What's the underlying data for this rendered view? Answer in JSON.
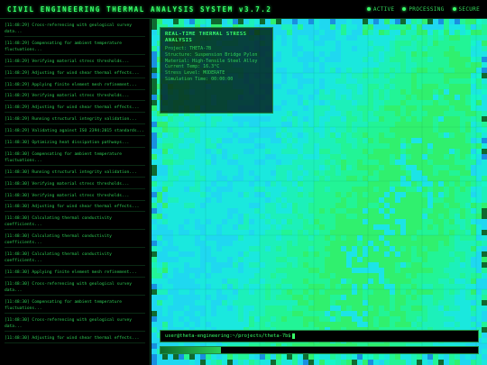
{
  "header": {
    "title": "CIVIL ENGINEERING THERMAL ANALYSIS SYSTEM v3.7.2",
    "status": [
      {
        "label": "ACTIVE",
        "color": "#39ff6a"
      },
      {
        "label": "PROCESSING",
        "color": "#39ff6a"
      },
      {
        "label": "SECURE",
        "color": "#39ff6a"
      }
    ]
  },
  "log": [
    "[11:48:29] Cross-referencing with geological survey data...",
    "[11:48:29] Compensating for ambient temperature fluctuations...",
    "[11:48:29] Verifying material stress thresholds...",
    "[11:48:29] Adjusting for wind shear thermal effects...",
    "[11:48:29] Applying finite element mesh refinement...",
    "[11:48:29] Verifying material stress thresholds...",
    "[11:48:29] Adjusting for wind shear thermal effects...",
    "[11:48:29] Running structural integrity validation...",
    "[11:48:29] Validating against ISO 2394:2015 standards...",
    "[11:48:30] Optimizing heat dissipation pathways...",
    "[11:48:30] Compensating for ambient temperature fluctuations...",
    "[11:48:30] Running structural integrity validation...",
    "[11:48:30] Verifying material stress thresholds...",
    "[11:48:30] Verifying material stress thresholds...",
    "[11:48:30] Adjusting for wind shear thermal effects...",
    "[11:48:30] Calculating thermal conductivity coefficients...",
    "[11:48:30] Calculating thermal conductivity coefficients...",
    "[11:48:30] Calculating thermal conductivity coefficients...",
    "[11:48:30] Applying finite element mesh refinement...",
    "[11:48:30] Cross-referencing with geological survey data...",
    "[11:48:30] Compensating for ambient temperature fluctuations...",
    "[11:48:30] Cross-referencing with geological survey data...",
    "[11:48:30] Adjusting for wind shear thermal effects..."
  ],
  "stats": {
    "title": "REAL-TIME THERMAL STRESS ANALYSIS",
    "rows": [
      "Project: THETA-7B",
      "Structure: Suspension Bridge Pylon",
      "Material: High-Tensile Steel Alloy",
      "Current Temp: 16.3°C",
      "Stress Level: MODERATE",
      "Simulation Time: 00:00:00"
    ]
  },
  "terminal": {
    "prompt": "user@theta-engineering:~/projects/theta-7b$"
  },
  "progress": {
    "fraction": 0.19
  },
  "colors": {
    "accent": "#39ff6a",
    "heat_low": "#20d8f0",
    "heat_mid": "#1cf0ba",
    "heat_high": "#33f060"
  }
}
